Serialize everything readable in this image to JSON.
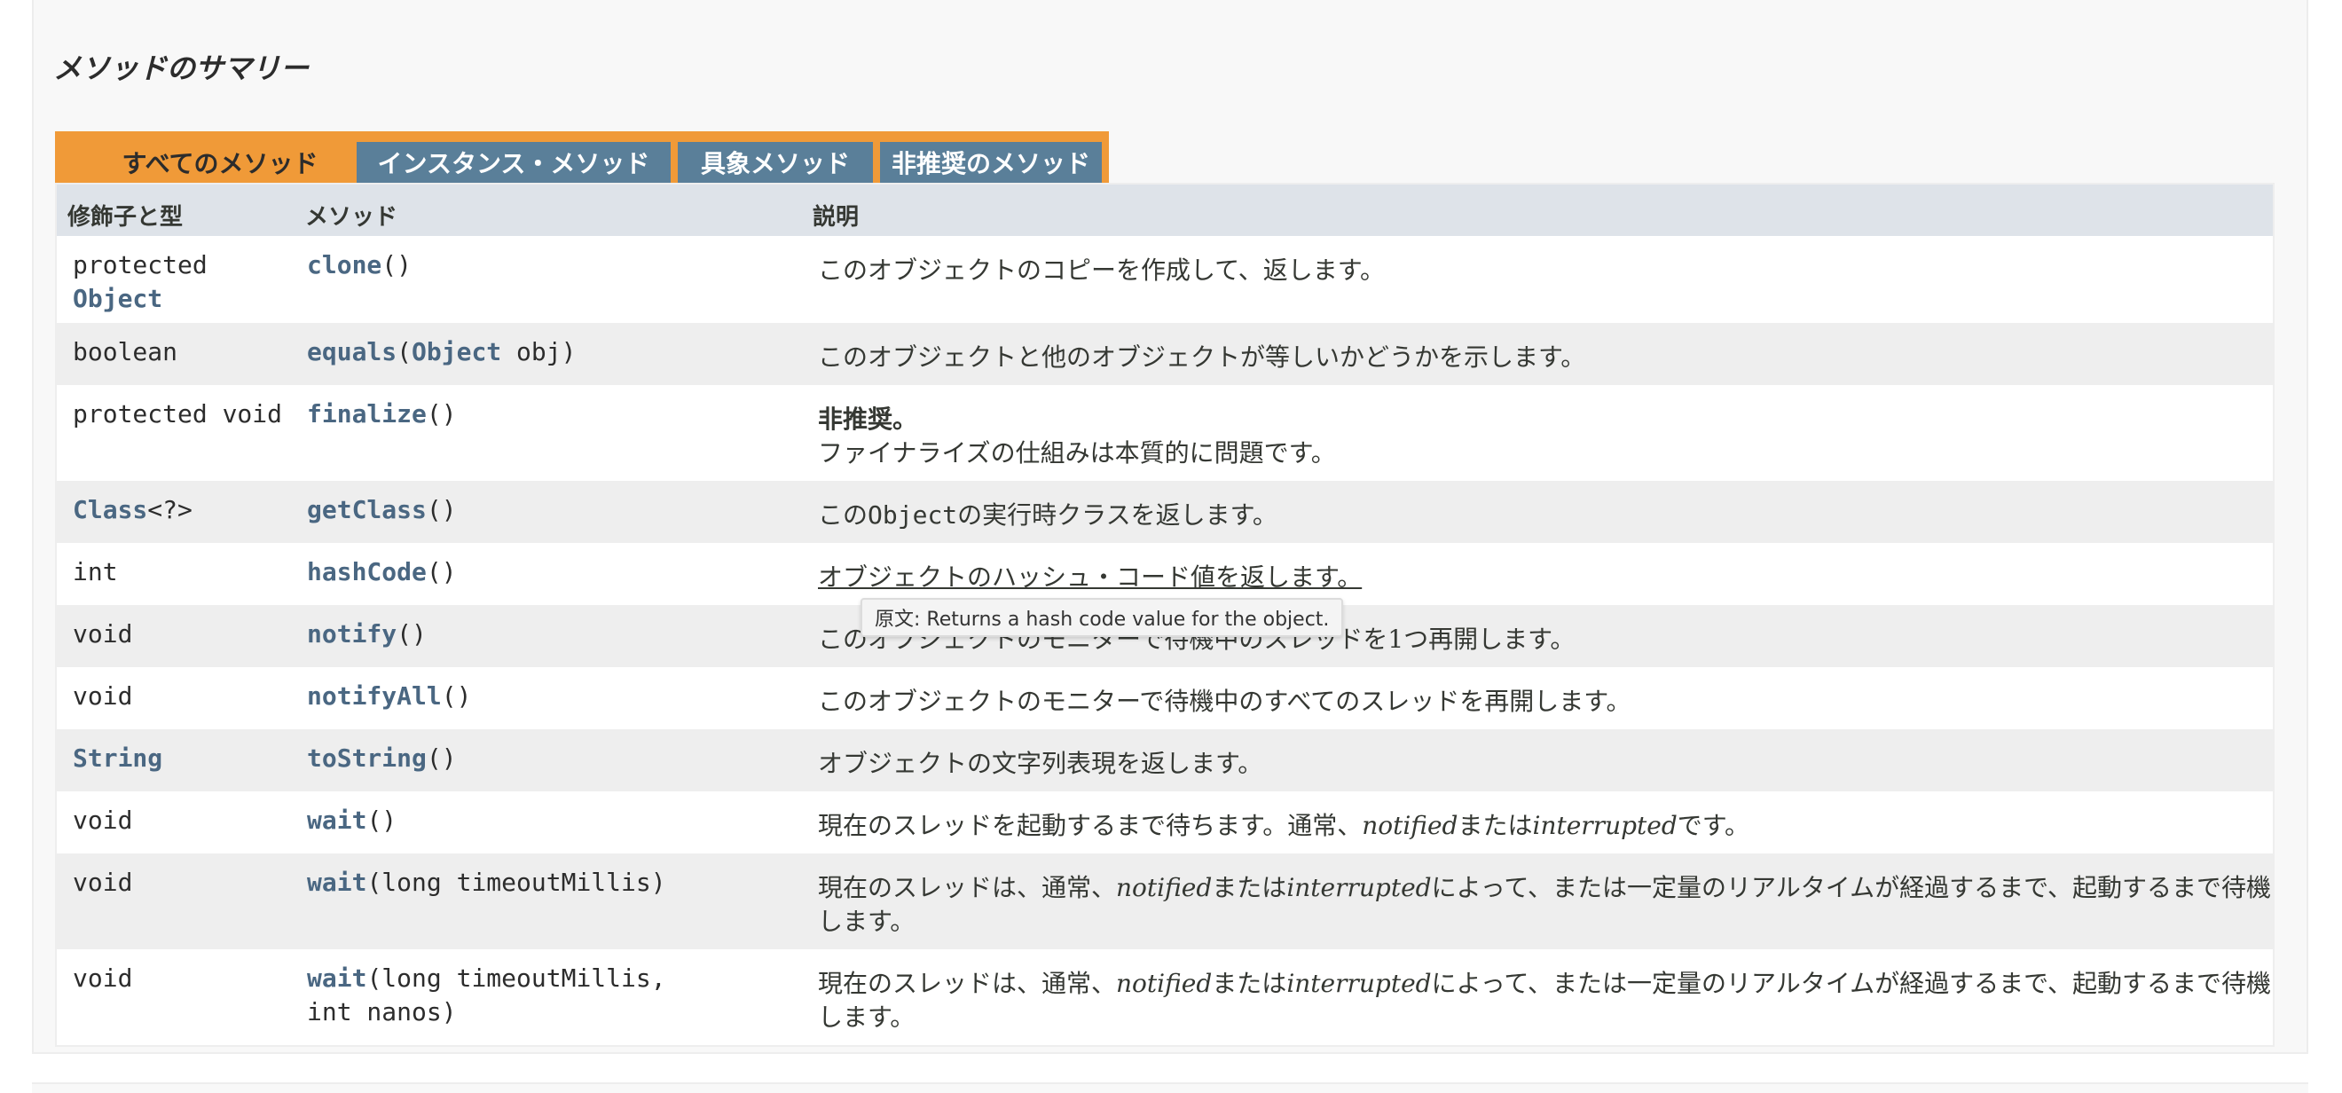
{
  "section": {
    "title": "メソッドのサマリー"
  },
  "tabs": [
    {
      "label": "すべてのメソッド",
      "active": true
    },
    {
      "label": "インスタンス・メソッド",
      "active": false
    },
    {
      "label": "具象メソッド",
      "active": false
    },
    {
      "label": "非推奨のメソッド",
      "active": false
    }
  ],
  "table": {
    "headers": {
      "type": "修飾子と型",
      "method": "メソッド",
      "description": "説明"
    },
    "rows": [
      {
        "type_prefix": "protected",
        "type_link": "Object",
        "method_name": "clone",
        "method_params": "()",
        "description": "このオブジェクトのコピーを作成して、返します。"
      },
      {
        "type_plain": "boolean",
        "method_name": "equals",
        "method_param_open": "(",
        "method_param_link": "Object",
        "method_param_rest": " obj)",
        "description": "このオブジェクトと他のオブジェクトが等しいかどうかを示します。"
      },
      {
        "type_plain": "protected void",
        "method_name": "finalize",
        "method_params": "()",
        "deprecated_label": "非推奨。",
        "description": "ファイナライズの仕組みは本質的に問題です。"
      },
      {
        "type_link": "Class",
        "type_suffix": "<?>",
        "method_name": "getClass",
        "method_params": "()",
        "description_pre": "この",
        "description_code": "Object",
        "description_post": "の実行時クラスを返します。"
      },
      {
        "type_plain": "int",
        "method_name": "hashCode",
        "method_params": "()",
        "description": "オブジェクトのハッシュ・コード値を返します。"
      },
      {
        "type_plain": "void",
        "method_name": "notify",
        "method_params": "()",
        "description": "このオブジェクトのモニターで待機中のスレッドを1つ再開します。"
      },
      {
        "type_plain": "void",
        "method_name": "notifyAll",
        "method_params": "()",
        "description": "このオブジェクトのモニターで待機中のすべてのスレッドを再開します。"
      },
      {
        "type_link": "String",
        "method_name": "toString",
        "method_params": "()",
        "description": "オブジェクトの文字列表現を返します。"
      },
      {
        "type_plain": "void",
        "method_name": "wait",
        "method_params": "()",
        "description_pre": "現在のスレッドを起動するまで待ちます。通常、",
        "description_em1": "notified",
        "description_mid": "または",
        "description_em2": "interrupted",
        "description_post": "です。"
      },
      {
        "type_plain": "void",
        "method_name": "wait",
        "method_params": "(long timeoutMillis)",
        "description_pre": "現在のスレッドは、通常、",
        "description_em1": "notified",
        "description_mid": "または",
        "description_em2": "interrupted",
        "description_post": "によって、または一定量のリアルタイムが経過するまで、起動するまで待機します。"
      },
      {
        "type_plain": "void",
        "method_name": "wait",
        "method_params": "(long timeoutMillis,",
        "method_params_line2": "int nanos)",
        "description_pre": "現在のスレッドは、通常、",
        "description_em1": "notified",
        "description_mid": "または",
        "description_em2": "interrupted",
        "description_post": "によって、または一定量のリアルタイムが経過するまで、起動するまで待機します。"
      }
    ]
  },
  "tooltip": {
    "text": "原文: Returns a hash code value for the object."
  },
  "colors": {
    "tab_active": "#f09a38",
    "tab_inactive": "#5a7f99",
    "header_bg": "#dee3e9",
    "link": "#4a6782"
  }
}
